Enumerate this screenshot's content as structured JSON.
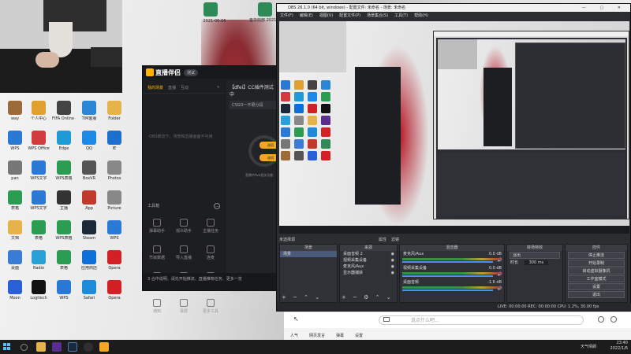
{
  "desktop": {
    "top_files": [
      {
        "label": "2021-06-06",
        "color": "#2e8b57"
      },
      {
        "label": "2021-06-06",
        "color": "#2e8b57"
      },
      {
        "label": "金华局部\n2021-06-06",
        "color": "#2e8b57"
      }
    ],
    "icons": [
      {
        "label": "way",
        "color": "#9b6b3a"
      },
      {
        "label": "个人中心",
        "color": "#e0a030"
      },
      {
        "label": "FIFA Online 4",
        "color": "#444"
      },
      {
        "label": "TIM客服",
        "color": "#2c86d6"
      },
      {
        "label": "Folder",
        "color": "#e6b34a"
      },
      {
        "label": "WPS",
        "color": "#2a7ad5"
      },
      {
        "label": "WPS Office",
        "color": "#d23b3b"
      },
      {
        "label": "Edge",
        "color": "#1e9bd7"
      },
      {
        "label": "QQ",
        "color": "#1e88e5"
      },
      {
        "label": "IE",
        "color": "#1d6fce"
      },
      {
        "label": "pan",
        "color": "#777"
      },
      {
        "label": "WPS文字",
        "color": "#2a7ad5"
      },
      {
        "label": "WPS表格",
        "color": "#2a9d52"
      },
      {
        "label": "BoxVR",
        "color": "#555"
      },
      {
        "label": "Photos",
        "color": "#888"
      },
      {
        "label": "表格",
        "color": "#2a9d52"
      },
      {
        "label": "WPS文字",
        "color": "#2a7ad5"
      },
      {
        "label": "主播",
        "color": "#333"
      },
      {
        "label": "App",
        "color": "#c0392b"
      },
      {
        "label": "Picture",
        "color": "#888"
      },
      {
        "label": "文档",
        "color": "#e6b34a"
      },
      {
        "label": "表格",
        "color": "#2a9d52"
      },
      {
        "label": "WPS表格",
        "color": "#2a9d52"
      },
      {
        "label": "Steam",
        "color": "#1b2838"
      },
      {
        "label": "WPS",
        "color": "#2a7ad5"
      },
      {
        "label": "桌面",
        "color": "#3a7bd5"
      },
      {
        "label": "Radio",
        "color": "#2aa0d8"
      },
      {
        "label": "表格",
        "color": "#2a9d52"
      },
      {
        "label": "应用商店",
        "color": "#0f6fd8"
      },
      {
        "label": "Opera",
        "color": "#d32027"
      },
      {
        "label": "Moon",
        "color": "#2a5fd8"
      },
      {
        "label": "Logitech",
        "color": "#111"
      },
      {
        "label": "WPS",
        "color": "#2a7ad5"
      },
      {
        "label": "Safari",
        "color": "#1d8bd8"
      },
      {
        "label": "Opera",
        "color": "#d32027"
      }
    ]
  },
  "companion": {
    "app_name": "直播伴侣",
    "version": "测试",
    "tabs": [
      "我的场景",
      "直播",
      "互动"
    ],
    "hint": "OBS推流下，场景和直播画面不可用",
    "tools_header": "工具箱",
    "tools": [
      {
        "label": "弹幕助手"
      },
      {
        "label": "观众助手"
      },
      {
        "label": "主播任务"
      },
      {
        "label": "节目数据"
      },
      {
        "label": "导入直播"
      },
      {
        "label": "连麦"
      },
      {
        "label": "礼物设置"
      },
      {
        "label": "分享直播"
      },
      {
        "label": "更多"
      },
      {
        "label": "通知"
      },
      {
        "label": "录屏"
      },
      {
        "label": "更多工具"
      }
    ],
    "footer": "3 合作说明、请先开始推流、直播推荐任务、更多一览",
    "stream_title": "【dfei】CC插件测试中",
    "stream_title_prefix": "CSGO一不限分段",
    "live_hint": "直播中Ava相关功能",
    "options": [
      "选项",
      "选项"
    ]
  },
  "obs": {
    "title": "OBS 26.1.0 (64 bit, windows) - 配置文件: 未命名 - 场景: 未命名",
    "menu": [
      "文件(F)",
      "编辑(E)",
      "视图(V)",
      "配置文件(P)",
      "场景集合(S)",
      "工具(T)",
      "帮助(H)"
    ],
    "dock_labels": [
      "未选择源",
      "属性",
      "滤镜"
    ],
    "scenes_header": "场景",
    "scenes": [
      "场景"
    ],
    "sources_header": "来源",
    "sources": [
      "桌面音频 2",
      "视频采集设备",
      "麦克风/Aux",
      "显示器捕获"
    ],
    "mixer_header": "混音器",
    "mixer": [
      {
        "name": "麦克风/Aux",
        "db": "0.0 dB"
      },
      {
        "name": "视频采集设备",
        "db": "0.0 dB"
      },
      {
        "name": "桌面音频",
        "db": "-1.6 dB"
      }
    ],
    "transitions_header": "转场特效",
    "transition": "淡出",
    "duration_label": "时长",
    "duration": "300 ms",
    "controls_header": "控件",
    "controls": [
      "停止推流",
      "开始录制",
      "启动虚拟摄像机",
      "工作室模式",
      "设置",
      "退出"
    ],
    "status": "LIVE: 00:00:00    REC: 00:00:00    CPU: 1.2%, 30.00 fps"
  },
  "chat": {
    "placeholder": "说点什么吧...",
    "bar": [
      "人气",
      "网页发言",
      "弹幕",
      "设置"
    ]
  },
  "taskbar": {
    "time": "23:40",
    "date": "2022/1/6",
    "tray_text": "天气晴朗"
  }
}
